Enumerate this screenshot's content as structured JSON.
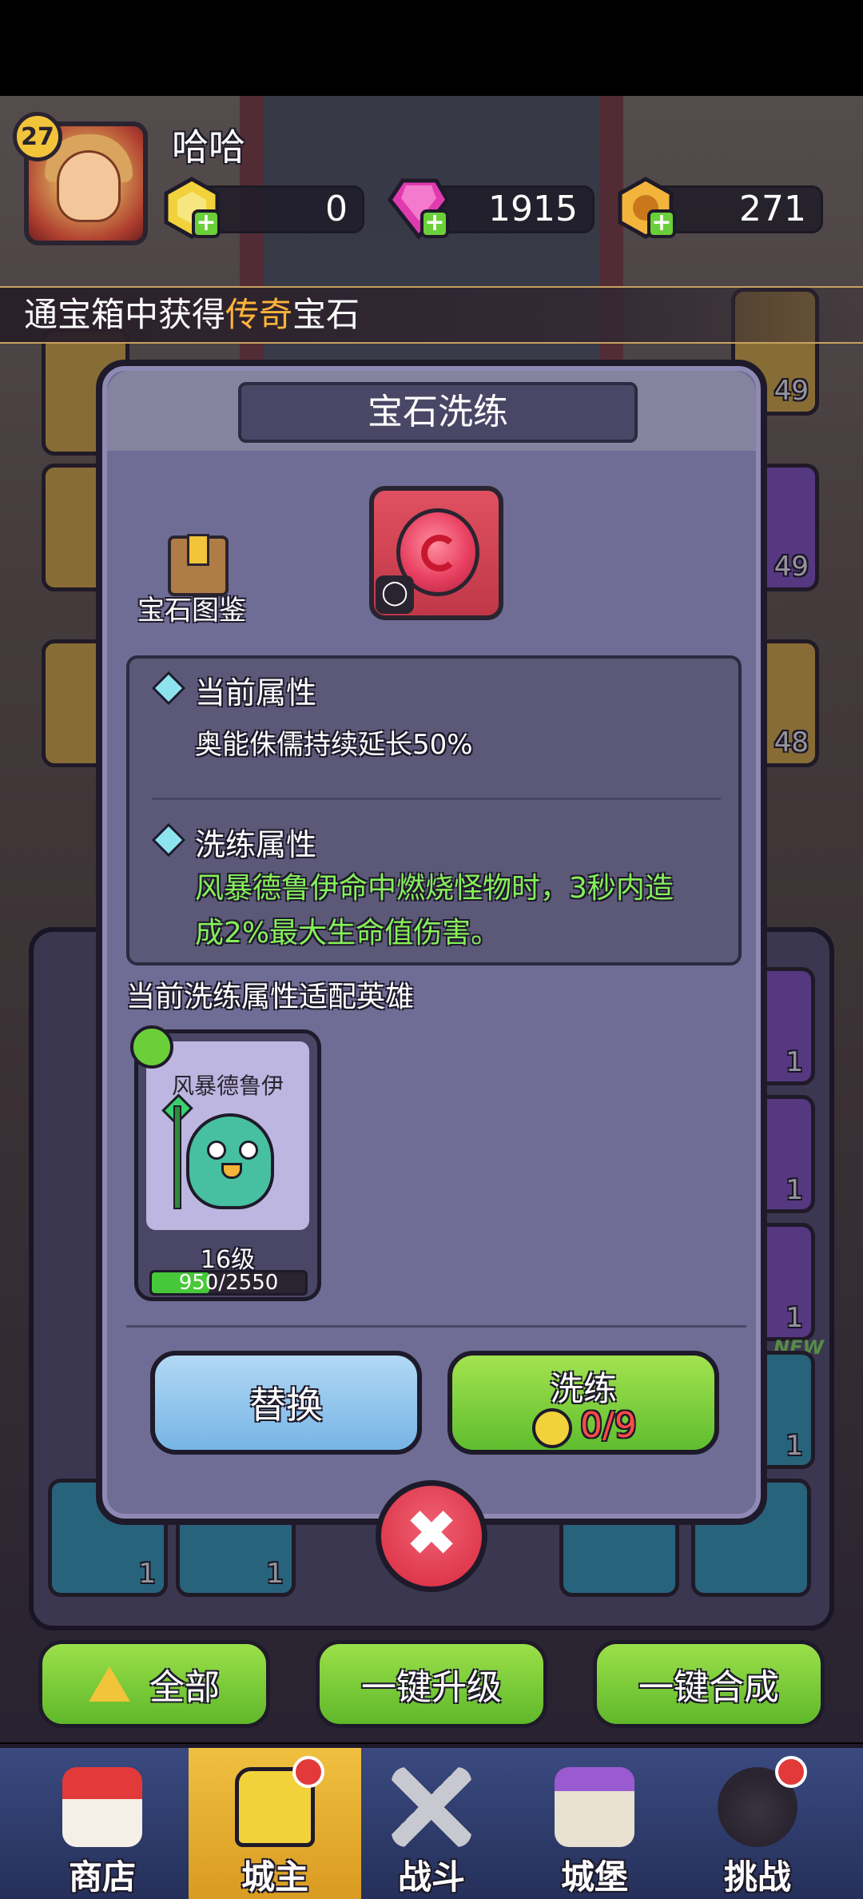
{
  "player": {
    "level": "27",
    "name": "哈哈"
  },
  "currencies": [
    {
      "name": "yellow-gem",
      "value": "0",
      "color": "#f2d23a"
    },
    {
      "name": "purple-gem",
      "value": "1915",
      "color": "#e03ab0"
    },
    {
      "name": "gold-coin",
      "value": "271",
      "color": "#f2b43a"
    }
  ],
  "banner": {
    "prefix": "通宝箱中获得",
    "highlight": "传奇",
    "suffix": "宝石"
  },
  "side_counts": {
    "right_top": "49",
    "right_mid": "49",
    "right_low": "48"
  },
  "grid_counts": [
    "1",
    "1",
    "1",
    "1",
    "1",
    "1"
  ],
  "new_tag": "NEW",
  "modal": {
    "title": "宝石洗练",
    "codex_label": "宝石图鉴",
    "current_attr_title": "当前属性",
    "current_attr_text": "奥能侏儒持续延长50%",
    "refine_attr_title": "洗练属性",
    "refine_attr_text_line1": "风暴德鲁伊命中燃烧怪物时，3秒内造",
    "refine_attr_text_line2": "成2%最大生命值伤害。",
    "fit_heroes_label": "当前洗练属性适配英雄",
    "hero": {
      "name": "风暴德鲁伊",
      "level": "16级",
      "exp_text": "950/2550",
      "exp_fraction": 0.3725
    },
    "replace_button": "替换",
    "refine_button": "洗练",
    "refine_cost": "0/9",
    "close_symbol": "✖"
  },
  "action_buttons": {
    "all": "全部",
    "upgrade_all": "一键升级",
    "merge_all": "一键合成"
  },
  "navbar": [
    {
      "label": "商店"
    },
    {
      "label": "城主",
      "active": true
    },
    {
      "label": "战斗"
    },
    {
      "label": "城堡"
    },
    {
      "label": "挑战"
    }
  ],
  "colors": {
    "accent_green": "#86ef5a",
    "highlight_orange": "#ffb43a",
    "cost_red": "#ff4a4a"
  }
}
